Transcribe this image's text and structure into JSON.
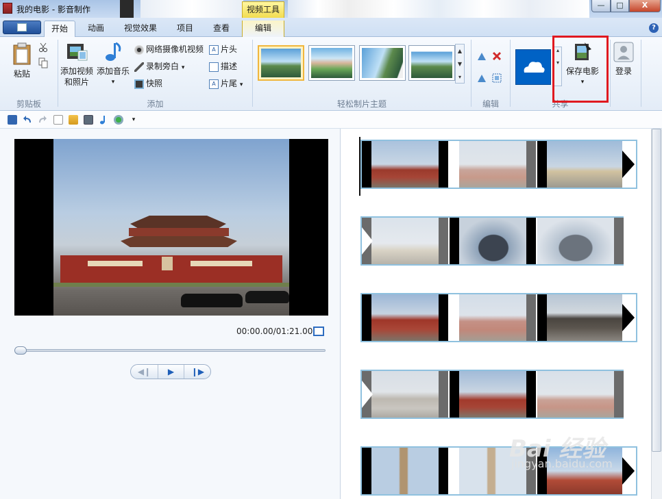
{
  "window": {
    "title": "我的电影 - 影音制作",
    "contextual_tab_header": "视频工具",
    "buttons": {
      "minimize": "—",
      "maximize": "□",
      "close": "X"
    }
  },
  "tabs": [
    {
      "label": "开始",
      "active": true
    },
    {
      "label": "动画"
    },
    {
      "label": "视觉效果"
    },
    {
      "label": "项目"
    },
    {
      "label": "查看"
    },
    {
      "label": "编辑",
      "contextual": true
    }
  ],
  "help_icon": "?",
  "ribbon": {
    "clipboard": {
      "group_label": "剪贴板",
      "paste_label": "粘贴",
      "cut_icon": "scissors-icon",
      "copy_icon": "copy-icon"
    },
    "add": {
      "group_label": "添加",
      "add_video_label_1": "添加视频",
      "add_video_label_2": "和照片",
      "add_music_label": "添加音乐",
      "add_music_arrow": "▾",
      "webcam_label": "网络摄像机视频",
      "narration_label": "录制旁白",
      "narration_arrow": "▾",
      "snapshot_label": "快照",
      "title_label": "片头",
      "caption_label": "描述",
      "credits_label": "片尾",
      "credits_arrow": "▾"
    },
    "themes": {
      "group_label": "轻松制片主题",
      "count": 4,
      "scroll_up": "▲",
      "scroll_down": "▼",
      "scroll_more": "▾"
    },
    "editing": {
      "group_label": "编辑"
    },
    "share": {
      "group_label": "共享",
      "cloud_icon": "onedrive-cloud-icon"
    },
    "save_movie": {
      "label": "保存电影",
      "arrow": "▾"
    },
    "sign_in": {
      "label": "登录"
    }
  },
  "quick_access": [
    "save-icon",
    "undo-icon",
    "redo-icon",
    "new-icon",
    "add-icon",
    "photo-icon",
    "music-icon",
    "snapshot-icon",
    "customize-icon"
  ],
  "preview": {
    "time_readout": "00:00.00/01:21.00",
    "seek_progress": 0.0,
    "prev_frame": "◀❙",
    "play": "▶",
    "next_frame": "❙▶"
  },
  "storyboard": {
    "rows": 5
  },
  "watermark": {
    "main": "Bai 经验",
    "sub": "jingyan.baidu.com"
  }
}
